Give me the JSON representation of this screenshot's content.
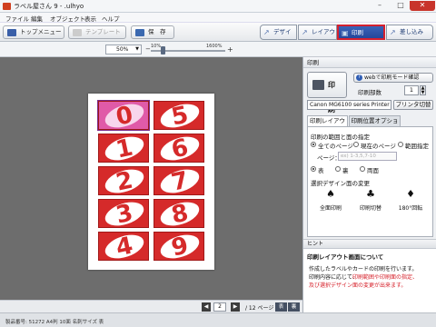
{
  "window": {
    "title": "ラベル屋さん 9 - .ulhyo",
    "min": "–",
    "max": "□",
    "close": "✕"
  },
  "menu": [
    "ファイル",
    "編集",
    "オブジェクト",
    "表示",
    "ヘルプ"
  ],
  "toolbar": {
    "top_menu": "トップメニュー",
    "template": "テンプレート",
    "save": "保　存"
  },
  "mode_tabs": [
    {
      "label": "デザイン",
      "icon": "arrow-icon"
    },
    {
      "label": "レイアウト",
      "icon": "arrow-icon"
    },
    {
      "label": "印刷",
      "icon": "printer-icon",
      "active": true
    },
    {
      "label": "差し込み",
      "icon": "arrow-icon"
    }
  ],
  "zoom": {
    "value": "50%",
    "min_label": "10%",
    "max_label": "1600%",
    "plus": "+",
    "minus": "−"
  },
  "cards": [
    "0",
    "5",
    "1",
    "6",
    "2",
    "7",
    "3",
    "8",
    "4",
    "9"
  ],
  "pagination": {
    "current": "2",
    "total": "/ 12 ページ",
    "view_a": "表",
    "view_b": "裏"
  },
  "status": "製品番号: 51272 A4判 10面 名刺サイズ 表",
  "panel": {
    "header": "印刷",
    "print_button": "印　刷",
    "web_button": "webで印刷モード確認",
    "copies_label": "印刷部数",
    "copies": "1",
    "printer": "Canon MG6100 series Printer",
    "printer_switch": "プリンタ切替",
    "tabs": [
      "印刷レイアウト",
      "印刷位置オプション"
    ],
    "range_label": "印刷の範囲と面の指定",
    "range_options": [
      "全てのページ",
      "現在のページ",
      "範囲指定"
    ],
    "pages_label": "ページ：",
    "pages_placeholder": "ex) 1-3,5,7-10",
    "side_options": [
      "表",
      "裏",
      "両面"
    ],
    "rotate_label": "選択デザイン面の変更",
    "rotate_buttons": [
      "全面印刷",
      "印刷切替",
      "180°回転"
    ],
    "hint_header": "ヒント",
    "hint_title": "印刷レイアウト画面について",
    "hint_lines": [
      {
        "text": "作成したラベルやカードの印刷を行います。",
        "red": false
      },
      {
        "text": "印刷内容に応じて、",
        "red": false
      },
      {
        "text": "印刷範囲や印刷面の指定、",
        "red": true
      },
      {
        "text": "及び選択デザイン面の変更が出来ます。",
        "red": true
      }
    ]
  }
}
